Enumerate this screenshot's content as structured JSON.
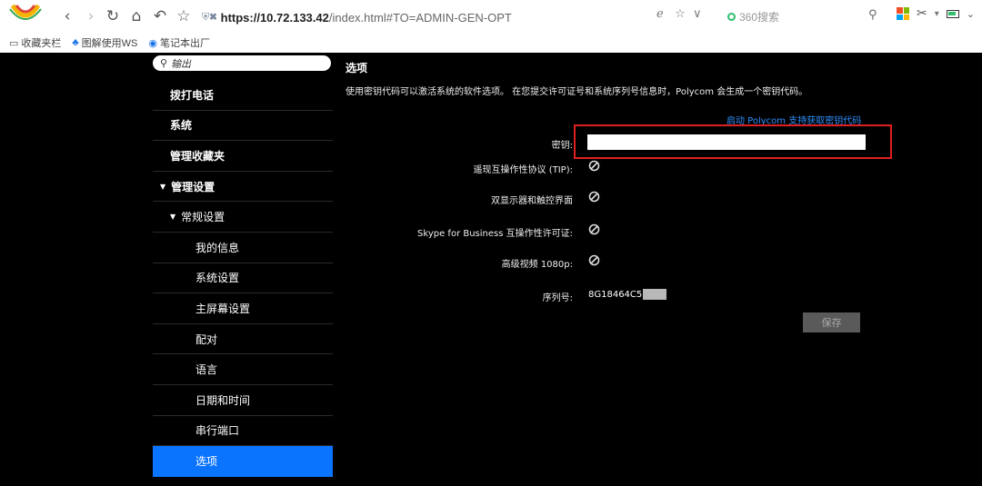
{
  "browser": {
    "url_host": "https://10.72.133.42",
    "url_path": "/index.html#TO=ADMIN-GEN-OPT",
    "search_placeholder": "360搜索",
    "bookmarks": [
      {
        "icon": "folder-icon",
        "label": "收藏夹栏"
      },
      {
        "icon": "tutorial-icon",
        "label": "图解使用WS"
      },
      {
        "icon": "note-icon",
        "label": "笔记本出厂"
      }
    ]
  },
  "sidebar": {
    "search_text": "输出",
    "items": [
      {
        "label": "拨打电话",
        "level": 0
      },
      {
        "label": "系统",
        "level": 0
      },
      {
        "label": "管理收藏夹",
        "level": 0
      },
      {
        "label": "管理设置",
        "level": 0,
        "expanded": true
      },
      {
        "label": "常规设置",
        "level": 1,
        "expanded": true
      },
      {
        "label": "我的信息",
        "level": 2
      },
      {
        "label": "系统设置",
        "level": 2
      },
      {
        "label": "主屏幕设置",
        "level": 2
      },
      {
        "label": "配对",
        "level": 2
      },
      {
        "label": "语言",
        "level": 2
      },
      {
        "label": "日期和时间",
        "level": 2
      },
      {
        "label": "串行端口",
        "level": 2
      },
      {
        "label": "选项",
        "level": 2,
        "active": true
      }
    ],
    "expand_glyph": "▼"
  },
  "content": {
    "heading": "选项",
    "description": "使用密钥代码可以激活系统的软件选项。 在您提交许可证号和系统序列号信息时，Polycom 会生成一个密钥代码。",
    "support_link": "启动 Polycom 支持获取密钥代码",
    "key_label": "密钥:",
    "key_value": "",
    "options": [
      {
        "label": "遥现互操作性协议 (TIP):",
        "enabled": false
      },
      {
        "label": "双显示器和触控界面",
        "enabled": false
      },
      {
        "label": "Skype for Business 互操作性许可证:",
        "enabled": false
      },
      {
        "label": "高级视频 1080p:",
        "enabled": false
      }
    ],
    "serial_label": "序列号:",
    "serial_value": "8G18464C5",
    "save_label": "保存"
  },
  "colors": {
    "active_item": "#0a74ff",
    "link": "#2f8ffd",
    "highlight_box": "#e02020",
    "save_button": "#5a5a5a"
  }
}
